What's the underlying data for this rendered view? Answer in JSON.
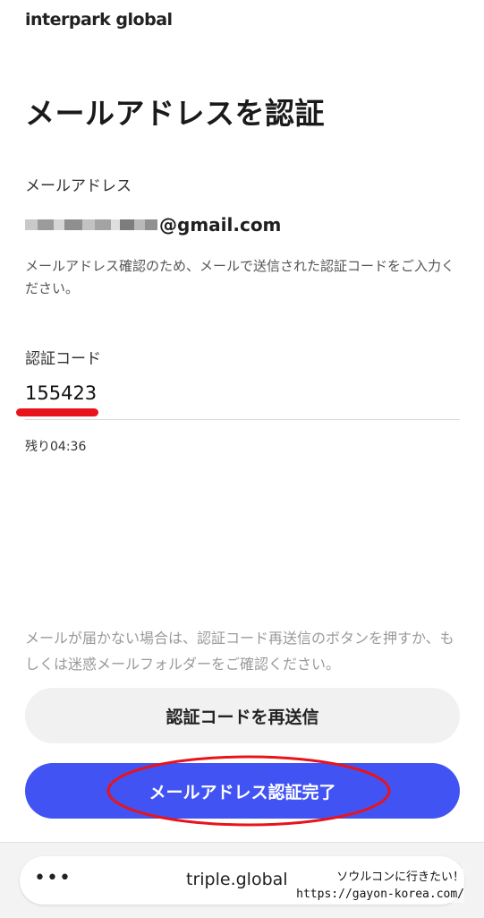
{
  "brand": {
    "logo_text": "interpark global"
  },
  "page": {
    "title": "メールアドレスを認証"
  },
  "email": {
    "label": "メールアドレス",
    "masked_prefix": "●●●●●●●●●●",
    "domain": "@gmail.com",
    "help_text": "メールアドレス確認のため、メールで送信された認証コードをご入力ください。"
  },
  "code": {
    "label": "認証コード",
    "value": "155423",
    "remaining": "残り04:36"
  },
  "notice": {
    "text": "メールが届かない場合は、認証コード再送信のボタンを押すか、もしくは迷惑メールフォルダーをご確認ください。"
  },
  "buttons": {
    "resend_label": "認証コードを再送信",
    "complete_label": "メールアドレス認証完了"
  },
  "browser": {
    "menu_icon": "more-dots-icon",
    "url": "triple.global"
  },
  "watermark": {
    "line1": "ソウルコンに行きたい！",
    "line2": "https://gayon-korea.com/"
  },
  "colors": {
    "primary": "#4154f3",
    "secondary_button": "#f1f1f1",
    "annotation_red": "#e8141c"
  }
}
